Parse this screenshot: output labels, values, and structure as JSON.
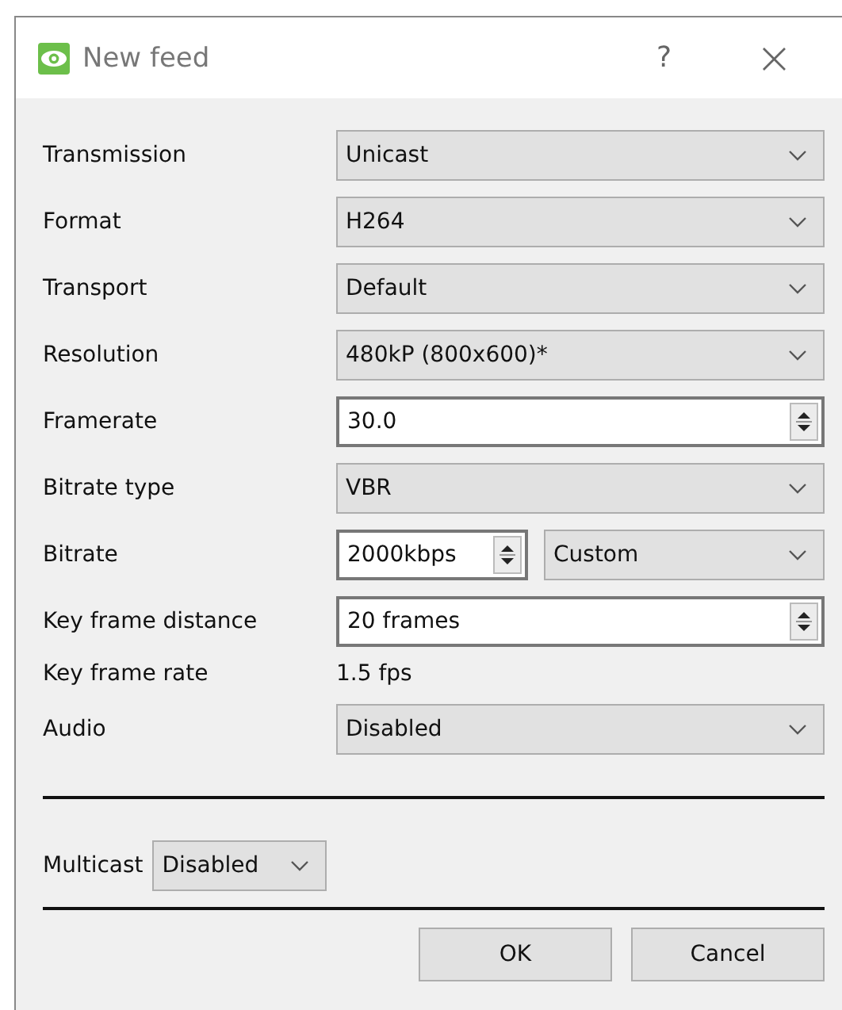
{
  "window": {
    "title": "New feed",
    "help": "?",
    "close": "×"
  },
  "fields": [
    {
      "label": "Transmission",
      "kind": "select",
      "value": "Unicast"
    },
    {
      "label": "Format",
      "kind": "select",
      "value": "H264"
    },
    {
      "label": "Transport",
      "kind": "select",
      "value": "Default"
    },
    {
      "label": "Resolution",
      "kind": "select",
      "value": "480kP (800x600)*"
    },
    {
      "label": "Framerate",
      "kind": "spin",
      "value": "30.0"
    },
    {
      "label": "Bitrate type",
      "kind": "select",
      "value": "VBR"
    },
    {
      "label": "Bitrate",
      "kind": "spin_select",
      "value": "2000kbps",
      "option": "Custom"
    },
    {
      "label": "Key frame distance",
      "kind": "spin",
      "value": "20 frames"
    },
    {
      "label": "Key frame rate",
      "kind": "text",
      "value": "1.5 fps"
    },
    {
      "label": "Audio",
      "kind": "select",
      "value": "Disabled"
    }
  ],
  "multicast": {
    "label": "Multicast",
    "value": "Disabled"
  },
  "buttons": [
    "OK",
    "Cancel"
  ]
}
